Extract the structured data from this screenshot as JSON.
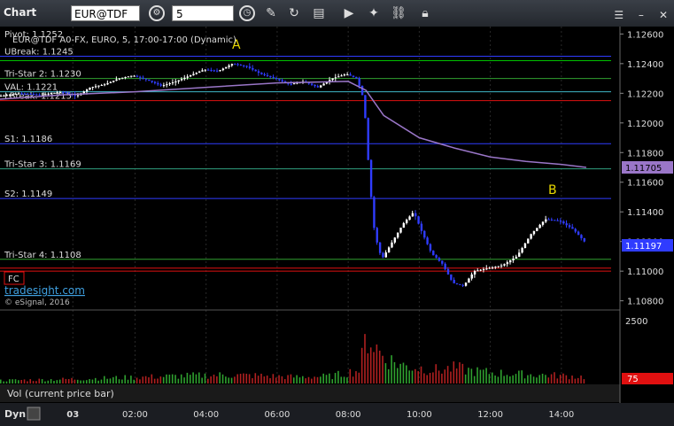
{
  "window": {
    "title": "Chart",
    "symbol": "EUR@TDF",
    "interval": "5"
  },
  "header": {
    "series_info": "EUR@TDF A0-FX, EURO, 5, 17:00-17:00 (Dynamic)",
    "pivot": "Pivot: 1.1252"
  },
  "levels": [
    {
      "label": "UBreak: 1.1245",
      "price": 1.1245,
      "color": "#2f3cff"
    },
    {
      "label": "",
      "price": 1.1242,
      "color": "#00c000"
    },
    {
      "label": "Tri-Star 2: 1.1230",
      "price": 1.123,
      "color": "#30a030"
    },
    {
      "label": "VAL: 1.1221",
      "price": 1.1221,
      "color": "#3fb8c8"
    },
    {
      "label": "LBreak: 1.1215",
      "price": 1.1215,
      "color": "#e01010"
    },
    {
      "label": "S1: 1.1186",
      "price": 1.1186,
      "color": "#2f3cff"
    },
    {
      "label": "Tri-Star 3: 1.1169",
      "price": 1.1169,
      "color": "#30a080"
    },
    {
      "label": "S2: 1.1149",
      "price": 1.1149,
      "color": "#2f3cff"
    },
    {
      "label": "Tri-Star 4: 1.1108",
      "price": 1.1108,
      "color": "#30a030"
    },
    {
      "label": "",
      "price": 1.1102,
      "color": "#e01010"
    },
    {
      "label": "",
      "price": 1.11,
      "color": "#e01010"
    }
  ],
  "annotations": [
    {
      "text": "A",
      "time": 4.85,
      "price": 1.125,
      "color": "#e8d800"
    },
    {
      "text": "B",
      "time": 13.75,
      "price": 1.1152,
      "color": "#e8d800"
    }
  ],
  "branding": {
    "site": "tradesight.com",
    "copyright": "© eSignal, 2016",
    "fc": "FC"
  },
  "volume_panel": {
    "label": "Vol (current price bar)",
    "scale_top": "2500",
    "current": "75",
    "current_color": "#e01010"
  },
  "price_axis": {
    "last_price": "1.11197",
    "last_price_color": "#2f3cff",
    "vwap": "1.11705",
    "vwap_color": "#9a76c8"
  },
  "footer": {
    "dyn": "Dyn",
    "date": "03"
  },
  "colors": {
    "up": "#ffffff",
    "down": "#2f3cff",
    "vwap": "#9a76c8"
  },
  "chart_data": {
    "type": "candlestick",
    "title": "EUR@TDF A0-FX, EURO, 5, 17:00-17:00 (Dynamic)",
    "ylim": [
      1.1075,
      1.1265
    ],
    "y_ticks": [
      "1.12600",
      "1.12400",
      "1.12200",
      "1.12000",
      "1.11800",
      "1.11600",
      "1.11400",
      "1.11200",
      "1.11000",
      "1.10800"
    ],
    "y_tick_values": [
      1.126,
      1.124,
      1.122,
      1.12,
      1.118,
      1.116,
      1.114,
      1.112,
      1.11,
      1.108
    ],
    "x_ticks": [
      "03",
      "02:00",
      "04:00",
      "06:00",
      "08:00",
      "10:00",
      "12:00",
      "14:00"
    ],
    "x_tick_hours": [
      0.25,
      2.0,
      4.0,
      6.0,
      8.0,
      10.0,
      12.0,
      14.0
    ],
    "xlim_hours": [
      -1.8,
      15.3
    ],
    "close_path": [
      [
        -1.8,
        1.1218
      ],
      [
        -1.2,
        1.122
      ],
      [
        -0.6,
        1.1219
      ],
      [
        0.0,
        1.1221
      ],
      [
        0.4,
        1.1218
      ],
      [
        0.8,
        1.1224
      ],
      [
        1.2,
        1.1226
      ],
      [
        1.6,
        1.123
      ],
      [
        2.0,
        1.1232
      ],
      [
        2.4,
        1.1229
      ],
      [
        2.8,
        1.1225
      ],
      [
        3.2,
        1.1228
      ],
      [
        3.6,
        1.1232
      ],
      [
        4.0,
        1.1236
      ],
      [
        4.4,
        1.1235
      ],
      [
        4.8,
        1.124
      ],
      [
        5.2,
        1.1238
      ],
      [
        5.6,
        1.1233
      ],
      [
        6.0,
        1.123
      ],
      [
        6.4,
        1.1226
      ],
      [
        6.8,
        1.1228
      ],
      [
        7.2,
        1.1224
      ],
      [
        7.6,
        1.123
      ],
      [
        8.0,
        1.1233
      ],
      [
        8.3,
        1.123
      ],
      [
        8.5,
        1.1215
      ],
      [
        8.6,
        1.118
      ],
      [
        8.7,
        1.115
      ],
      [
        8.8,
        1.1125
      ],
      [
        9.0,
        1.1108
      ],
      [
        9.3,
        1.112
      ],
      [
        9.6,
        1.1132
      ],
      [
        9.9,
        1.114
      ],
      [
        10.1,
        1.1128
      ],
      [
        10.4,
        1.1112
      ],
      [
        10.7,
        1.1105
      ],
      [
        11.0,
        1.1092
      ],
      [
        11.3,
        1.109
      ],
      [
        11.6,
        1.11
      ],
      [
        12.0,
        1.1102
      ],
      [
        12.4,
        1.1104
      ],
      [
        12.8,
        1.111
      ],
      [
        13.2,
        1.1125
      ],
      [
        13.6,
        1.1135
      ],
      [
        14.0,
        1.1134
      ],
      [
        14.4,
        1.1128
      ],
      [
        14.7,
        1.112
      ]
    ],
    "vwap_path": [
      [
        -1.8,
        1.1216
      ],
      [
        0.0,
        1.1219
      ],
      [
        2.0,
        1.1221
      ],
      [
        4.0,
        1.1224
      ],
      [
        6.0,
        1.1227
      ],
      [
        8.0,
        1.1228
      ],
      [
        8.5,
        1.1222
      ],
      [
        9.0,
        1.1205
      ],
      [
        10.0,
        1.119
      ],
      [
        11.0,
        1.1183
      ],
      [
        12.0,
        1.1177
      ],
      [
        13.0,
        1.1174
      ],
      [
        14.0,
        1.1172
      ],
      [
        14.7,
        1.117
      ]
    ],
    "volume": [
      [
        -1.8,
        120
      ],
      [
        -0.5,
        150
      ],
      [
        0.5,
        180
      ],
      [
        1.5,
        220
      ],
      [
        2.5,
        260
      ],
      [
        3.5,
        300
      ],
      [
        4.5,
        330
      ],
      [
        5.5,
        300
      ],
      [
        6.5,
        250
      ],
      [
        7.5,
        280
      ],
      [
        8.3,
        520
      ],
      [
        8.5,
        1900
      ],
      [
        8.7,
        1500
      ],
      [
        9.0,
        1000
      ],
      [
        9.5,
        700
      ],
      [
        10.0,
        600
      ],
      [
        10.5,
        520
      ],
      [
        11.0,
        600
      ],
      [
        11.5,
        480
      ],
      [
        12.0,
        420
      ],
      [
        12.5,
        380
      ],
      [
        13.0,
        350
      ],
      [
        13.5,
        330
      ],
      [
        14.0,
        300
      ],
      [
        14.7,
        250
      ]
    ],
    "volume_max": 2500
  }
}
